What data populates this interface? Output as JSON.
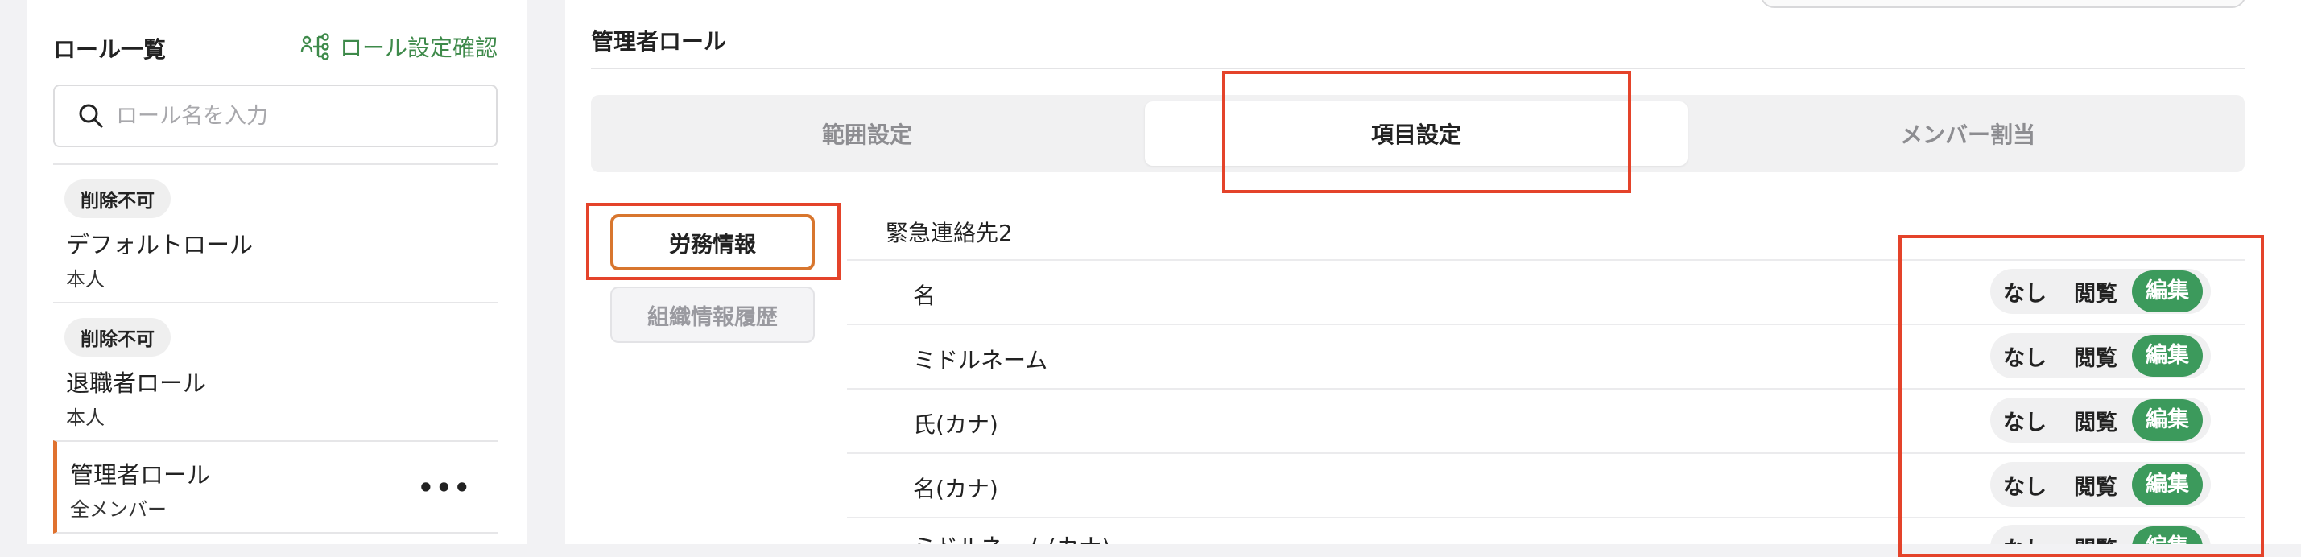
{
  "sidebar": {
    "title": "ロール一覧",
    "link_label": "ロール設定確認",
    "search_placeholder": "ロール名を入力",
    "roles": [
      {
        "badge": "削除不可",
        "name": "デフォルトロール",
        "sub": "本人"
      },
      {
        "badge": "削除不可",
        "name": "退職者ロール",
        "sub": "本人"
      },
      {
        "name": "管理者ロール",
        "sub": "全メンバー",
        "more": "•••"
      }
    ]
  },
  "main": {
    "title": "管理者ロール",
    "tabs": [
      "範囲設定",
      "項目設定",
      "メンバー割当"
    ],
    "active_tab": "項目設定",
    "categories": [
      "労務情報",
      "組織情報履歴"
    ],
    "section_title": "緊急連絡先2",
    "options": [
      "なし",
      "閲覧",
      "編集"
    ],
    "fields": [
      "名",
      "ミドルネーム",
      "氏(カナ)",
      "名(カナ)",
      "ミドルネーム(カナ)"
    ],
    "selected_option": "編集"
  },
  "colors": {
    "accent_green": "#3c9a5c",
    "active_orange": "#d8762e",
    "highlight_red": "#e4432a"
  }
}
